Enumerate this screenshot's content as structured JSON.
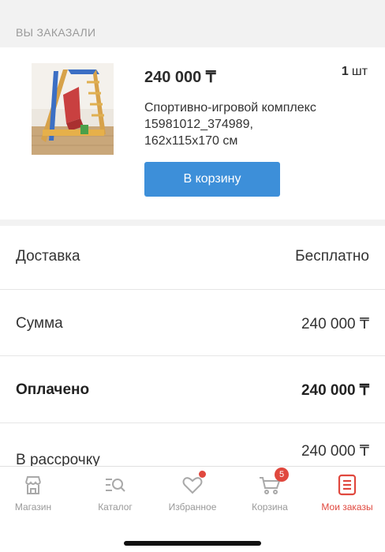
{
  "section": {
    "title": "ВЫ ЗАКАЗАЛИ"
  },
  "order": {
    "price": "240 000 ₸",
    "quantity": "1",
    "quantity_unit": "шт",
    "name_lines": [
      "Спортивно-игровой комплекс",
      "15981012_374989,",
      "162x115x170 см"
    ],
    "cart_button_label": "В корзину",
    "cart_button_color": "#3d8fd9"
  },
  "summary": {
    "rows": [
      {
        "label": "Доставка",
        "value": "Бесплатно"
      },
      {
        "label": "Сумма",
        "value": "240 000 ₸"
      },
      {
        "label": "Оплачено",
        "value": "240 000 ₸"
      },
      {
        "label": "В рассрочку",
        "value": "240 000 ₸"
      }
    ]
  },
  "tabbar": {
    "tabs": [
      {
        "label": "Магазин",
        "icon": "store-icon"
      },
      {
        "label": "Каталог",
        "icon": "catalog-search-icon"
      },
      {
        "label": "Избранное",
        "icon": "heart-icon"
      },
      {
        "label": "Корзина",
        "icon": "cart-icon",
        "badge": "5"
      },
      {
        "label": "Мои заказы",
        "icon": "orders-icon",
        "active": true
      }
    ],
    "accent_color": "#e0483e"
  }
}
